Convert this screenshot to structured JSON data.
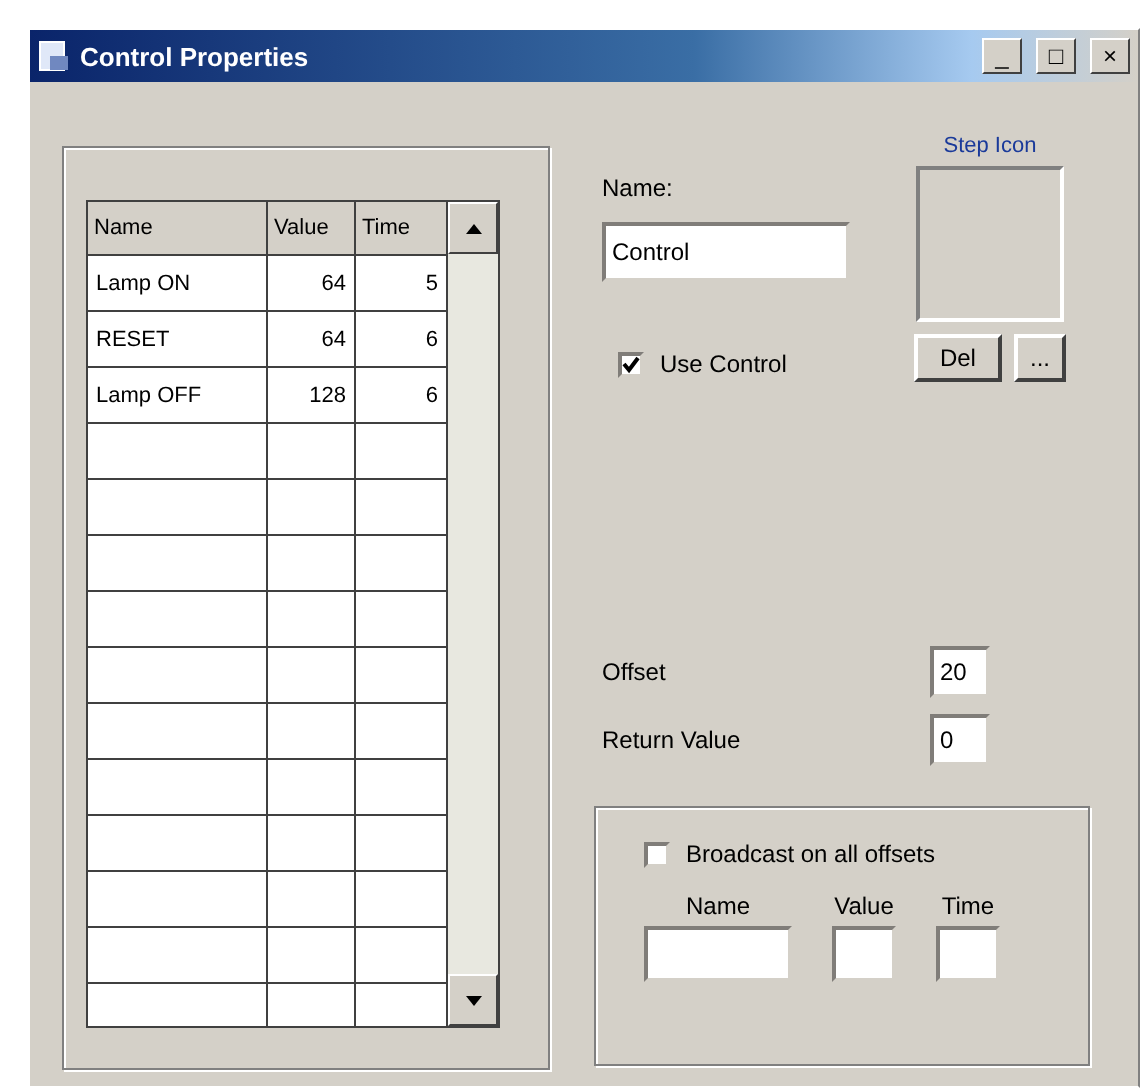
{
  "window": {
    "title": "Control Properties",
    "controls": [
      "_",
      "□",
      "×"
    ]
  },
  "table": {
    "columns": [
      "Name",
      "Value",
      "Time"
    ],
    "rows": [
      {
        "cells": [
          "Lamp ON",
          "64",
          "5"
        ]
      },
      {
        "cells": [
          "RESET",
          "64",
          "6"
        ]
      },
      {
        "cells": [
          "Lamp OFF",
          "128",
          "6"
        ]
      }
    ]
  },
  "name_label": "Name:",
  "name_value": "Control",
  "step_icon": {
    "label": "Step Icon",
    "buttons": [
      "Del",
      "..."
    ]
  },
  "use_control": {
    "label": "Use Control",
    "checked": true
  },
  "offset": {
    "label": "Offset",
    "value": "20"
  },
  "return_value": {
    "label": "Return Value",
    "value": "0"
  },
  "broadcast": {
    "label": "Broadcast on all offsets",
    "checked": false,
    "fields": [
      "Name",
      "Value",
      "Time"
    ]
  }
}
